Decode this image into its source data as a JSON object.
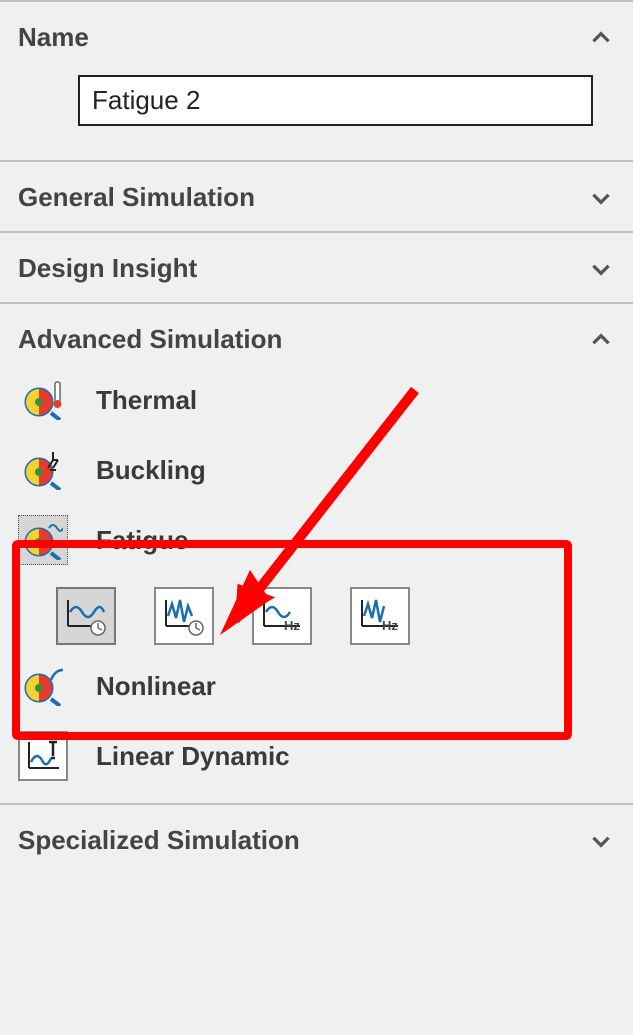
{
  "sections": {
    "name": {
      "title": "Name",
      "input_value": "Fatigue 2"
    },
    "general": {
      "title": "General Simulation"
    },
    "design": {
      "title": "Design Insight"
    },
    "advanced": {
      "title": "Advanced Simulation",
      "items": {
        "thermal": "Thermal",
        "buckling": "Buckling",
        "fatigue": "Fatigue",
        "nonlinear": "Nonlinear",
        "linear_dynamic": "Linear Dynamic"
      }
    },
    "specialized": {
      "title": "Specialized Simulation"
    }
  },
  "colors": {
    "annotation": "#ff0000"
  }
}
